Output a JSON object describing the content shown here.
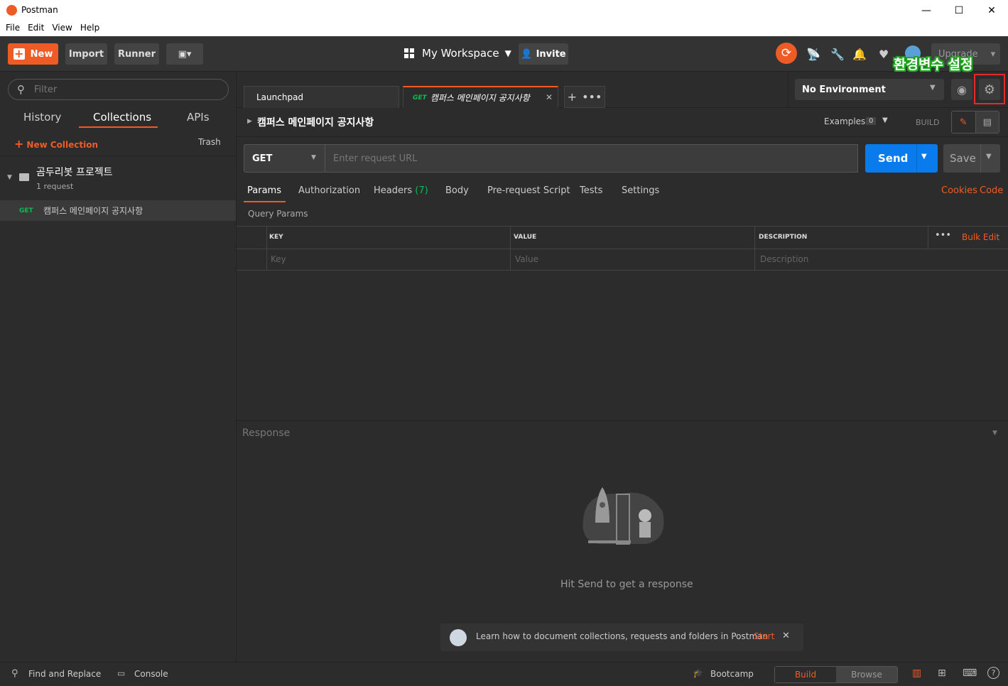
{
  "window": {
    "title": "Postman",
    "minimize": "—",
    "maximize": "☐",
    "close": "✕"
  },
  "menu": [
    "File",
    "Edit",
    "View",
    "Help"
  ],
  "header": {
    "new_label": "New",
    "import_label": "Import",
    "runner_label": "Runner",
    "workspace_label": "My Workspace",
    "invite_label": "Invite",
    "upgrade_label": "Upgrade"
  },
  "sidebar": {
    "filter_placeholder": "Filter",
    "tabs": [
      "History",
      "Collections",
      "APIs"
    ],
    "new_collection_label": "New Collection",
    "trash_label": "Trash",
    "collection": {
      "name": "곰두리봇 프로젝트",
      "count": "1 request"
    },
    "request": {
      "method": "GET",
      "name": "캠퍼스 메인페이지 공지사항"
    }
  },
  "tabs": {
    "launchpad": "Launchpad",
    "active_method": "GET",
    "active_name": "캠퍼스 메인페이지 공지사항"
  },
  "environment": {
    "selected": "No Environment"
  },
  "annotation": "환경변수 설정",
  "request": {
    "title": "캠퍼스 메인페이지 공지사항",
    "examples_label": "Examples",
    "examples_count": "0",
    "build_label": "BUILD",
    "method": "GET",
    "url_placeholder": "Enter request URL",
    "send_label": "Send",
    "save_label": "Save",
    "subtabs": [
      "Params",
      "Authorization",
      "Headers",
      "Body",
      "Pre-request Script",
      "Tests",
      "Settings"
    ],
    "headers_count": "(7)",
    "cookies_label": "Cookies",
    "code_label": "Code",
    "query_params_label": "Query Params",
    "columns": {
      "key": "KEY",
      "value": "VALUE",
      "description": "DESCRIPTION"
    },
    "bulk_edit_label": "Bulk Edit",
    "placeholders": {
      "key": "Key",
      "value": "Value",
      "description": "Description"
    }
  },
  "response": {
    "heading": "Response",
    "empty_text": "Hit Send to get a response",
    "tip_text": "Learn how to document collections, requests and folders in Postman",
    "tip_link": "Start"
  },
  "footer": {
    "find_replace": "Find and Replace",
    "console": "Console",
    "bootcamp": "Bootcamp",
    "build": "Build",
    "browse": "Browse"
  },
  "colors": {
    "accent": "#ef5b25",
    "send": "#097bed",
    "get": "#0cbb52",
    "annotation": "#1fa51f",
    "highlight": "#e32b2b"
  }
}
